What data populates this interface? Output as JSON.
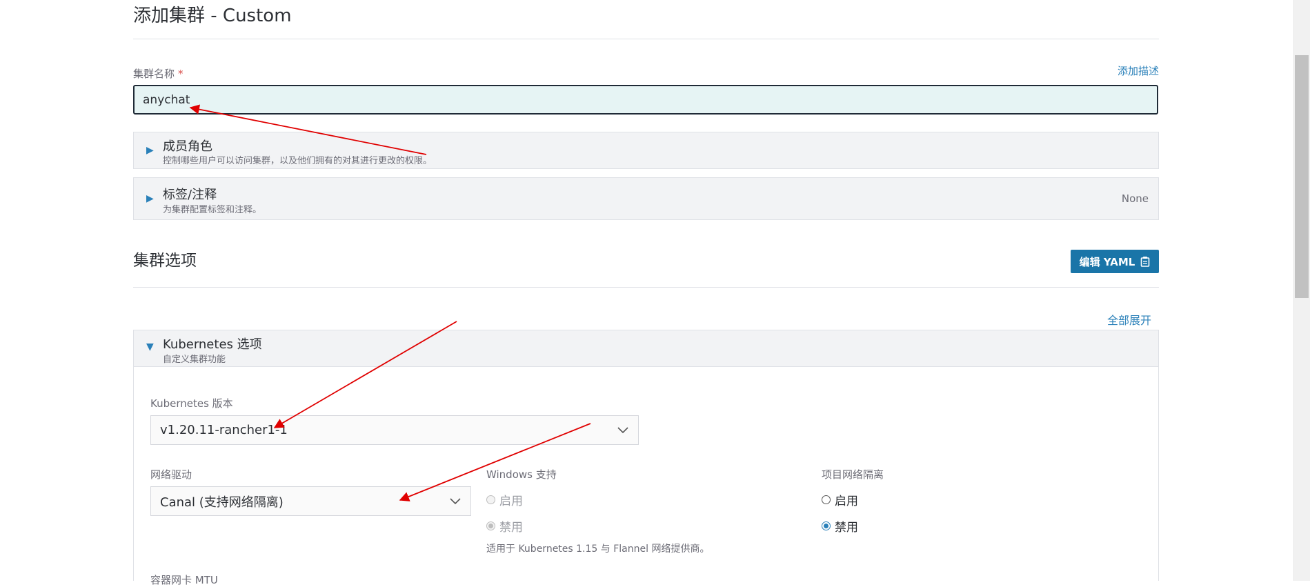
{
  "page": {
    "title": "添加集群 - Custom"
  },
  "cluster_name": {
    "label": "集群名称",
    "required_mark": "*",
    "value": "anychat",
    "add_description_link": "添加描述"
  },
  "accordions": [
    {
      "title": "成员角色",
      "subtitle": "控制哪些用户可以访问集群，以及他们拥有的对其进行更改的权限。",
      "state": "collapsed"
    },
    {
      "title": "标签/注释",
      "subtitle": "为集群配置标签和注释。",
      "value": "None",
      "state": "collapsed"
    }
  ],
  "cluster_options": {
    "heading": "集群选项",
    "edit_yaml_button": "编辑 YAML",
    "expand_all_link": "全部展开",
    "kubernetes": {
      "title": "Kubernetes 选项",
      "subtitle": "自定义集群功能",
      "version": {
        "label": "Kubernetes 版本",
        "value": "v1.20.11-rancher1-1"
      },
      "network": {
        "label": "网络驱动",
        "value": "Canal (支持网络隔离)"
      },
      "windows": {
        "label": "Windows 支持",
        "options": [
          "启用",
          "禁用"
        ],
        "selected": "禁用",
        "disabled": true,
        "note": "适用于 Kubernetes 1.15 与 Flannel 网络提供商。"
      },
      "project_isolation": {
        "label": "项目网络隔离",
        "options": [
          "启用",
          "禁用"
        ],
        "selected": "禁用"
      },
      "next_label": "容器网卡 MTU"
    }
  },
  "colors": {
    "accent": "#2a80b9",
    "button": "#1a75a8",
    "annotation_arrow": "#e00000",
    "input_bg": "#e6f4f4"
  },
  "icons": [
    "expand-triangle-icon",
    "collapse-triangle-icon",
    "clipboard-icon",
    "chevron-down-icon"
  ]
}
